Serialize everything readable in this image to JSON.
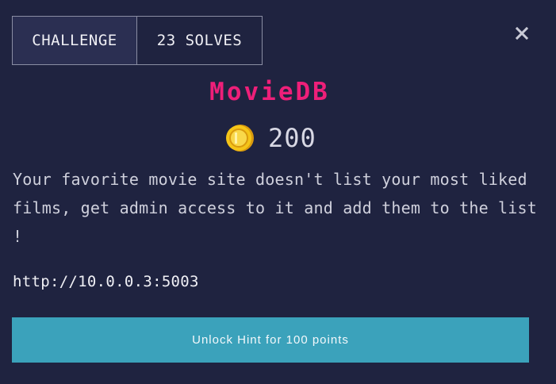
{
  "tabs": [
    {
      "label": "CHALLENGE",
      "active": true
    },
    {
      "label": "23 SOLVES",
      "active": false
    }
  ],
  "close_icon": "close-icon",
  "challenge": {
    "title": "MovieDB",
    "points": "200",
    "description": "Your favorite movie site doesn't list your most liked films, get admin access to it and add them to the list !",
    "url": "http://10.0.0.3:5003"
  },
  "hint_button": {
    "label": "Unlock Hint for 100 points"
  },
  "colors": {
    "background": "#1f2340",
    "title": "#ee1f79",
    "hint_button": "#3ba2bb",
    "coin": "#f5c518"
  }
}
